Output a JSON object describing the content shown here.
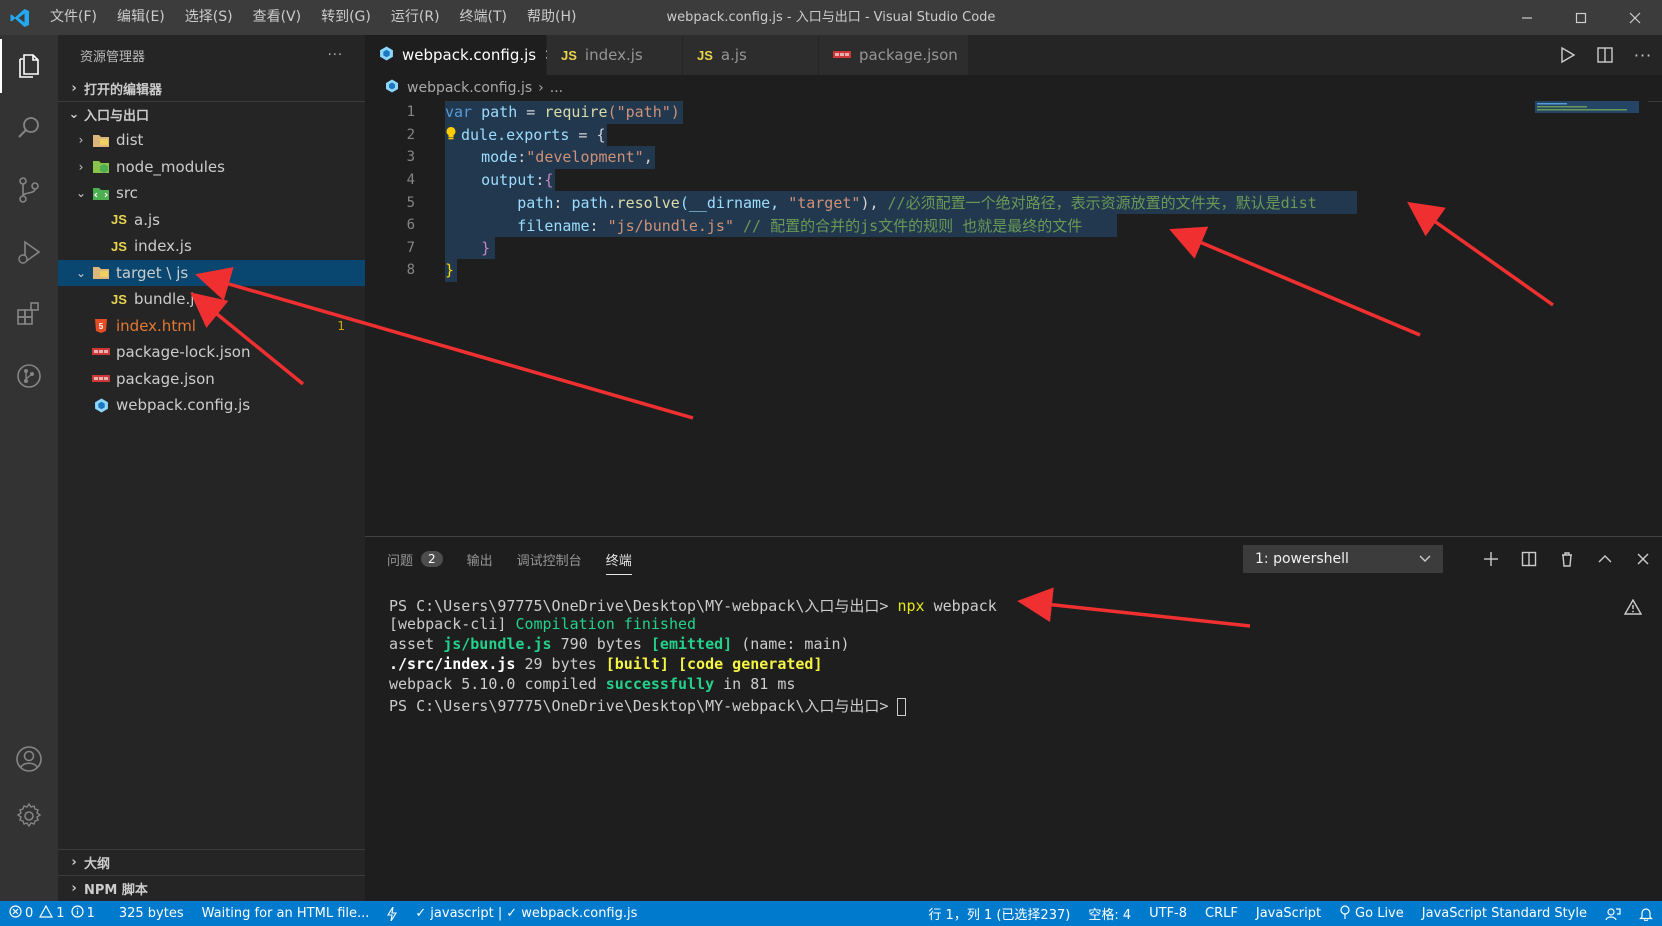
{
  "window": {
    "title": "webpack.config.js - 入口与出口 - Visual Studio Code",
    "menu": [
      "文件(F)",
      "编辑(E)",
      "选择(S)",
      "查看(V)",
      "转到(G)",
      "运行(R)",
      "终端(T)",
      "帮助(H)"
    ]
  },
  "sidebar": {
    "header": "资源管理器",
    "more": "···",
    "open_editors": "打开的编辑器",
    "workspace": "入口与出口",
    "tree": [
      {
        "label": "dist",
        "type": "folder",
        "indent": 1,
        "chev": "›"
      },
      {
        "label": "node_modules",
        "type": "folder-node",
        "indent": 1,
        "chev": "›"
      },
      {
        "label": "src",
        "type": "folder-src",
        "indent": 1,
        "chev": "⌄"
      },
      {
        "label": "a.js",
        "type": "js",
        "indent": 2
      },
      {
        "label": "index.js",
        "type": "js",
        "indent": 2
      },
      {
        "label": "target \\ js",
        "type": "folder",
        "indent": 1,
        "chev": "⌄",
        "selected": true
      },
      {
        "label": "bundle.js",
        "type": "js",
        "indent": 2
      },
      {
        "label": "index.html",
        "type": "html",
        "indent": 1,
        "badge": "1",
        "color": "#e37933"
      },
      {
        "label": "package-lock.json",
        "type": "npm",
        "indent": 1
      },
      {
        "label": "package.json",
        "type": "npm",
        "indent": 1
      },
      {
        "label": "webpack.config.js",
        "type": "webpack",
        "indent": 1
      }
    ],
    "outline": "大纲",
    "npm_scripts": "NPM 脚本"
  },
  "tabs": [
    {
      "label": "webpack.config.js",
      "icon": "webpack-icon",
      "active": true,
      "close": "✕"
    },
    {
      "label": "index.js",
      "icon": "js-icon"
    },
    {
      "label": "a.js",
      "icon": "js-icon"
    },
    {
      "label": "package.json",
      "icon": "npm-icon"
    }
  ],
  "breadcrumb": {
    "file": "webpack.config.js",
    "sep": "›",
    "rest": "..."
  },
  "code": [
    {
      "n": "1"
    },
    {
      "n": "2"
    },
    {
      "n": "3"
    },
    {
      "n": "4"
    },
    {
      "n": "5"
    },
    {
      "n": "6"
    },
    {
      "n": "7"
    },
    {
      "n": "8"
    }
  ],
  "code_text": {
    "l1": {
      "kw": "var",
      "v": "path",
      "eq": " = ",
      "fn": "require",
      "s": "(\"path\")"
    },
    "l2": {
      "a": "dule.exports",
      "b": " = {"
    },
    "l3": {
      "key": "mode",
      "colon": ":",
      "s": "\"development\"",
      "end": ","
    },
    "l4": {
      "key": "output",
      "colon": ":",
      "br": "{"
    },
    "l5": {
      "key": "path",
      "colon": ": ",
      "obj": "path",
      "dot": ".",
      "fn": "resolve",
      "args": "(__dirname, ",
      "s": "\"target\"",
      "end": "), ",
      "comment": "//必须配置一个绝对路径，表示资源放置的文件夹，默认是dist"
    },
    "l6": {
      "key": "filename",
      "colon": ": ",
      "s": "\"js/bundle.js\"",
      "comment": " // 配置的合并的js文件的规则 也就是最终的文件"
    },
    "l7": {
      "br": "}"
    },
    "l8": {
      "br": "}"
    }
  },
  "panel": {
    "tabs": [
      {
        "label": "问题",
        "badge": "2"
      },
      {
        "label": "输出"
      },
      {
        "label": "调试控制台"
      },
      {
        "label": "终端",
        "active": true
      }
    ],
    "terminal_select": "1: powershell",
    "terminal": {
      "l1_prompt": "PS C:\\Users\\97775\\OneDrive\\Desktop\\MY-webpack\\入口与出口> ",
      "l1_cmd": "npx",
      "l1_arg": " webpack",
      "l2_a": "[webpack-cli] ",
      "l2_b": "Compilation finished",
      "l3_a": "asset ",
      "l3_b": "js/bundle.js",
      "l3_c": " 790 bytes ",
      "l3_d": "[emitted]",
      "l3_e": " (name: main)",
      "l4_a": "./src/index.js",
      "l4_b": " 29 bytes ",
      "l4_c": "[built] [code generated]",
      "l5_a": "webpack 5.10.0 compiled ",
      "l5_b": "successfully",
      "l5_c": " in 81 ms",
      "l6_prompt": "PS C:\\Users\\97775\\OneDrive\\Desktop\\MY-webpack\\入口与出口> "
    }
  },
  "status": {
    "errors": "0",
    "warnings": "1",
    "infos": "1",
    "size": "325 bytes",
    "html_msg": "Waiting for an HTML file...",
    "lint": "javascript | ",
    "lint_file": "webpack.config.js",
    "position": "行 1，列 1 (已选择237)",
    "spaces": "空格: 4",
    "encoding": "UTF-8",
    "eol": "CRLF",
    "language": "JavaScript",
    "golive": "Go Live",
    "style": "JavaScript Standard Style"
  },
  "colors": {
    "accent": "#007acc",
    "selection": "#094771"
  }
}
